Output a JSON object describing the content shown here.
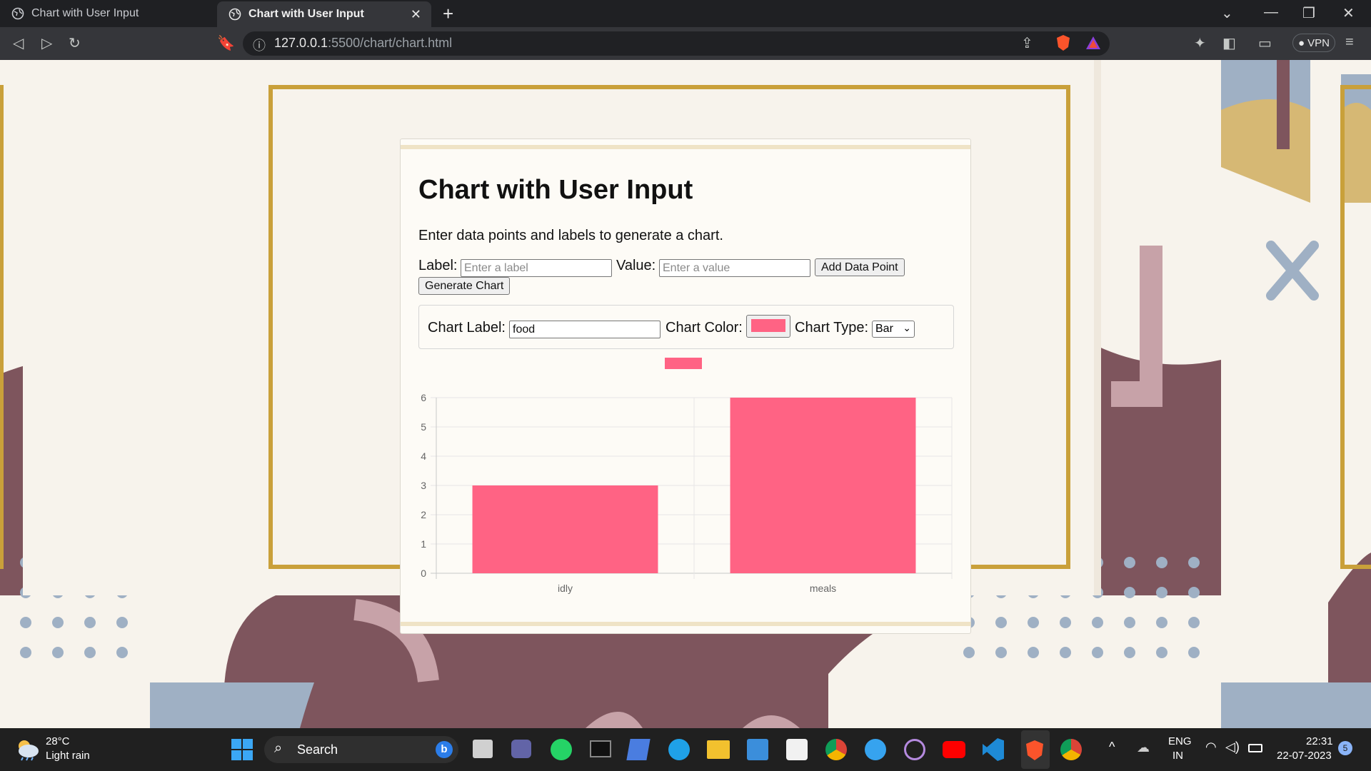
{
  "browser": {
    "tabs": [
      {
        "label": "Chart with User Input",
        "active": false
      },
      {
        "label": "Chart with User Input",
        "active": true
      }
    ],
    "url_host": "127.0.0.1",
    "url_rest": ":5500/chart/chart.html",
    "vpn_label": "VPN"
  },
  "app": {
    "title": "Chart with User Input",
    "subtitle": "Enter data points and labels to generate a chart.",
    "label_field_label": "Label:",
    "label_placeholder": "Enter a label",
    "value_field_label": "Value:",
    "value_placeholder": "Enter a value",
    "add_button": "Add Data Point",
    "generate_button": "Generate Chart",
    "chart_label_label": "Chart Label:",
    "chart_label_value": "food",
    "chart_color_label": "Chart Color:",
    "chart_color": "#ff6384",
    "chart_type_label": "Chart Type:",
    "chart_type_value": "Bar"
  },
  "chart_data": {
    "type": "bar",
    "categories": [
      "idly",
      "meals"
    ],
    "series": [
      {
        "values": [
          3,
          6
        ]
      }
    ],
    "ylim": [
      0,
      6
    ],
    "yticks": [
      0,
      1,
      2,
      3,
      4,
      5,
      6
    ],
    "legend": "top-center",
    "grid": true,
    "color": "#ff6384"
  },
  "taskbar": {
    "weather_temp": "28°C",
    "weather_desc": "Light rain",
    "search_label": "Search",
    "lang_top": "ENG",
    "lang_bottom": "IN",
    "time": "22:31",
    "date": "22-07-2023",
    "notification_count": "5"
  }
}
